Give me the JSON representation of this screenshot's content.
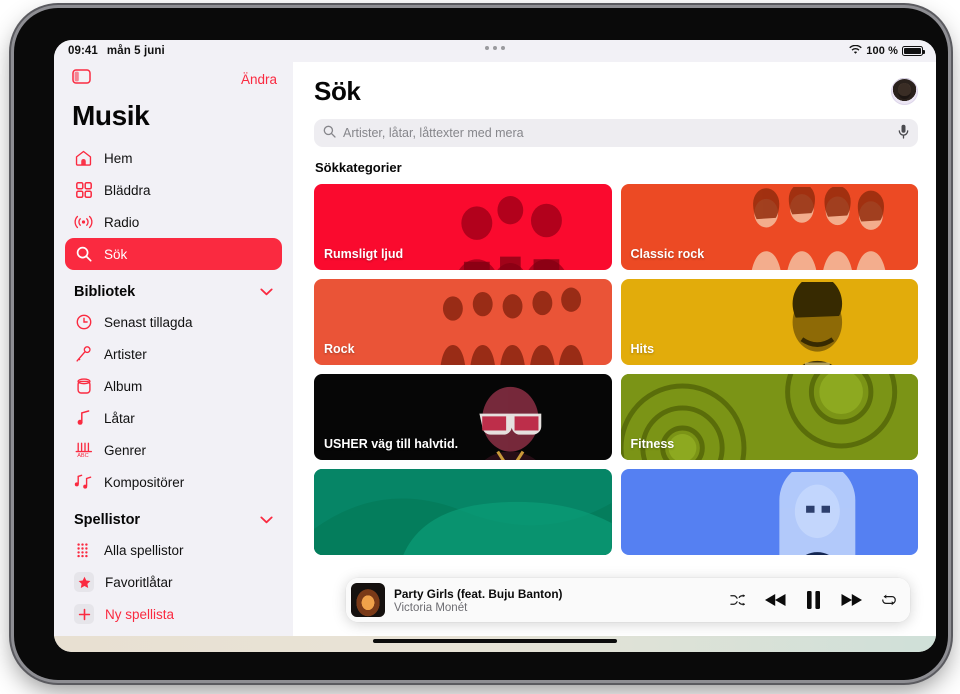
{
  "status_bar": {
    "time": "09:41",
    "date": "mån 5 juni",
    "battery_percent": "100 %",
    "wifi_icon": "wifi-icon",
    "battery_icon": "battery-icon",
    "multitask_handle": "three-dots-handle"
  },
  "sidebar": {
    "toggle_icon": "sidebar-toggle-icon",
    "edit_label": "Ändra",
    "title": "Musik",
    "nav": [
      {
        "label": "Hem",
        "icon": "house-icon",
        "selected": false
      },
      {
        "label": "Bläddra",
        "icon": "grid-squares-icon",
        "selected": false
      },
      {
        "label": "Radio",
        "icon": "radio-waves-icon",
        "selected": false
      },
      {
        "label": "Sök",
        "icon": "magnifier-icon",
        "selected": true
      }
    ],
    "library": {
      "header": "Bibliotek",
      "chevron_icon": "chevron-down-icon",
      "items": [
        {
          "label": "Senast tillagda",
          "icon": "clock-icon"
        },
        {
          "label": "Artister",
          "icon": "microphone-icon"
        },
        {
          "label": "Album",
          "icon": "album-disc-icon"
        },
        {
          "label": "Låtar",
          "icon": "music-note-icon"
        },
        {
          "label": "Genrer",
          "icon": "genres-icon"
        },
        {
          "label": "Kompositörer",
          "icon": "double-note-icon"
        }
      ]
    },
    "playlists": {
      "header": "Spellistor",
      "chevron_icon": "chevron-down-icon",
      "items": [
        {
          "label": "Alla spellistor",
          "icon": "playlist-grid-icon",
          "accent": false
        },
        {
          "label": "Favoritlåtar",
          "icon": "star-icon",
          "accent": false
        },
        {
          "label": "Ny spellista",
          "icon": "plus-icon",
          "accent": true
        }
      ]
    }
  },
  "main": {
    "page_title": "Sök",
    "avatar": "user-avatar",
    "search": {
      "placeholder": "Artister, låtar, låttexter med mera",
      "value": "",
      "search_icon": "magnifier-icon",
      "mic_icon": "microphone-icon"
    },
    "section_title": "Sökkategorier",
    "cards": [
      {
        "label": "Rumsligt ljud",
        "color": "#fa0a2e",
        "art": "group-trio"
      },
      {
        "label": "Classic rock",
        "color": "#ec4a24",
        "art": "band-four"
      },
      {
        "label": "Rock",
        "color": "#ea5437",
        "art": "band-five"
      },
      {
        "label": "Hits",
        "color": "#e2ac0b",
        "art": "solo-male"
      },
      {
        "label": "USHER väg till halvtid.",
        "color": "#060606",
        "art": "usher-sunglasses"
      },
      {
        "label": "Fitness",
        "color": "#7b9416",
        "art": "weights-rings"
      },
      {
        "label": "",
        "color": "#068566",
        "art": "abstract-teal"
      },
      {
        "label": "",
        "color": "#5580f2",
        "art": "solo-female"
      }
    ]
  },
  "now_playing": {
    "artwork": "album-artwork",
    "title": "Party Girls (feat. Buju Banton)",
    "artist": "Victoria Monét",
    "controls": [
      {
        "name": "shuffle-button",
        "icon": "shuffle-icon"
      },
      {
        "name": "previous-button",
        "icon": "rewind-icon"
      },
      {
        "name": "play-pause-button",
        "icon": "pause-icon"
      },
      {
        "name": "next-button",
        "icon": "fast-forward-icon"
      },
      {
        "name": "repeat-button",
        "icon": "repeat-icon"
      }
    ]
  },
  "home_indicator": "home-indicator-bar"
}
